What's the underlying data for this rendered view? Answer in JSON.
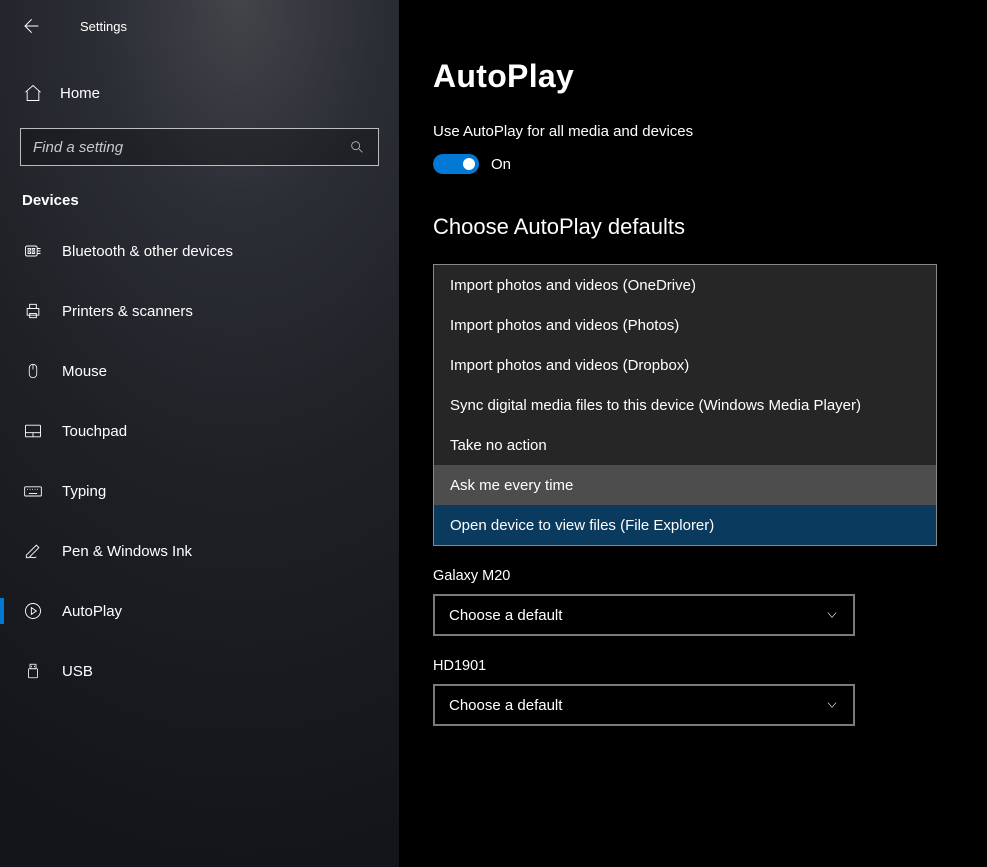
{
  "header": {
    "app_title": "Settings"
  },
  "sidebar": {
    "home_label": "Home",
    "search_placeholder": "Find a setting",
    "category": "Devices",
    "items": [
      {
        "icon": "bluetooth",
        "label": "Bluetooth & other devices",
        "active": false
      },
      {
        "icon": "printer",
        "label": "Printers & scanners",
        "active": false
      },
      {
        "icon": "mouse",
        "label": "Mouse",
        "active": false
      },
      {
        "icon": "touchpad",
        "label": "Touchpad",
        "active": false
      },
      {
        "icon": "keyboard",
        "label": "Typing",
        "active": false
      },
      {
        "icon": "pen",
        "label": "Pen & Windows Ink",
        "active": false
      },
      {
        "icon": "autoplay",
        "label": "AutoPlay",
        "active": true
      },
      {
        "icon": "usb",
        "label": "USB",
        "active": false
      }
    ]
  },
  "main": {
    "title": "AutoPlay",
    "toggle_label": "Use AutoPlay for all media and devices",
    "toggle_state": "On",
    "section_title": "Choose AutoPlay defaults",
    "dropdown_options": [
      {
        "label": "Import photos and videos (OneDrive)",
        "state": "normal"
      },
      {
        "label": "Import photos and videos (Photos)",
        "state": "normal"
      },
      {
        "label": "Import photos and videos (Dropbox)",
        "state": "normal"
      },
      {
        "label": "Sync digital media files to this device (Windows Media Player)",
        "state": "normal"
      },
      {
        "label": "Take no action",
        "state": "normal"
      },
      {
        "label": "Ask me every time",
        "state": "hover"
      },
      {
        "label": "Open device to view files (File Explorer)",
        "state": "selected"
      }
    ],
    "devices": [
      {
        "name": "Galaxy M20",
        "value": "Choose a default"
      },
      {
        "name": "HD1901",
        "value": "Choose a default"
      }
    ]
  }
}
